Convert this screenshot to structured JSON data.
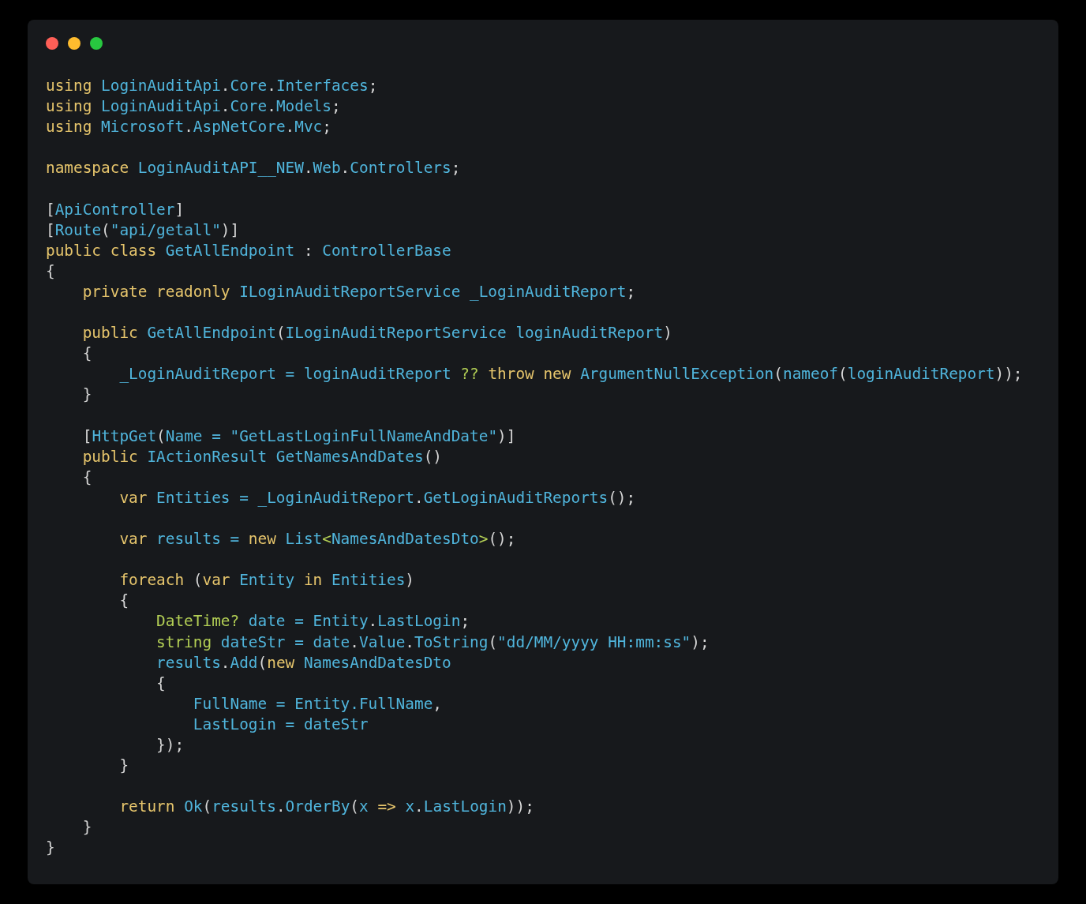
{
  "window": {
    "controls": [
      {
        "color": "#ff5f57"
      },
      {
        "color": "#febc2e"
      },
      {
        "color": "#28c840"
      }
    ]
  },
  "code": {
    "lines": [
      {
        "kind": "code",
        "tokens": [
          {
            "kind": "kw",
            "text": "using "
          },
          {
            "kind": "id",
            "text": "LoginAuditApi"
          },
          {
            "kind": "p",
            "text": "."
          },
          {
            "kind": "id",
            "text": "Core"
          },
          {
            "kind": "p",
            "text": "."
          },
          {
            "kind": "id",
            "text": "Interfaces"
          },
          {
            "kind": "p",
            "text": ";"
          }
        ]
      },
      {
        "kind": "code",
        "tokens": [
          {
            "kind": "kw",
            "text": "using "
          },
          {
            "kind": "id",
            "text": "LoginAuditApi"
          },
          {
            "kind": "p",
            "text": "."
          },
          {
            "kind": "id",
            "text": "Core"
          },
          {
            "kind": "p",
            "text": "."
          },
          {
            "kind": "id",
            "text": "Models"
          },
          {
            "kind": "p",
            "text": ";"
          }
        ]
      },
      {
        "kind": "code",
        "tokens": [
          {
            "kind": "kw",
            "text": "using "
          },
          {
            "kind": "id",
            "text": "Microsoft"
          },
          {
            "kind": "p",
            "text": "."
          },
          {
            "kind": "id",
            "text": "AspNetCore"
          },
          {
            "kind": "p",
            "text": "."
          },
          {
            "kind": "id",
            "text": "Mvc"
          },
          {
            "kind": "p",
            "text": ";"
          }
        ]
      },
      {
        "kind": "blank"
      },
      {
        "kind": "code",
        "tokens": [
          {
            "kind": "kw",
            "text": "namespace "
          },
          {
            "kind": "id",
            "text": "LoginAuditAPI__NEW"
          },
          {
            "kind": "p",
            "text": "."
          },
          {
            "kind": "id",
            "text": "Web"
          },
          {
            "kind": "p",
            "text": "."
          },
          {
            "kind": "id",
            "text": "Controllers"
          },
          {
            "kind": "p",
            "text": ";"
          }
        ]
      },
      {
        "kind": "blank"
      },
      {
        "kind": "code",
        "tokens": [
          {
            "kind": "p",
            "text": "["
          },
          {
            "kind": "id",
            "text": "ApiController"
          },
          {
            "kind": "p",
            "text": "]"
          }
        ]
      },
      {
        "kind": "code",
        "tokens": [
          {
            "kind": "p",
            "text": "["
          },
          {
            "kind": "id",
            "text": "Route"
          },
          {
            "kind": "p",
            "text": "("
          },
          {
            "kind": "id",
            "text": "\"api/getall\""
          },
          {
            "kind": "p",
            "text": ")]"
          }
        ]
      },
      {
        "kind": "code",
        "tokens": [
          {
            "kind": "kw",
            "text": "public class "
          },
          {
            "kind": "id",
            "text": "GetAllEndpoint "
          },
          {
            "kind": "p",
            "text": ": "
          },
          {
            "kind": "id",
            "text": "ControllerBase"
          }
        ]
      },
      {
        "kind": "code",
        "tokens": [
          {
            "kind": "p",
            "text": "{"
          }
        ]
      },
      {
        "kind": "code",
        "tokens": [
          {
            "kind": "kw",
            "text": "    private readonly "
          },
          {
            "kind": "id",
            "text": "ILoginAuditReportService _LoginAuditReport"
          },
          {
            "kind": "p",
            "text": ";"
          }
        ]
      },
      {
        "kind": "blank"
      },
      {
        "kind": "code",
        "tokens": [
          {
            "kind": "kw",
            "text": "    public "
          },
          {
            "kind": "id",
            "text": "GetAllEndpoint"
          },
          {
            "kind": "p",
            "text": "("
          },
          {
            "kind": "id",
            "text": "ILoginAuditReportService loginAuditReport"
          },
          {
            "kind": "p",
            "text": ")"
          }
        ]
      },
      {
        "kind": "code",
        "tokens": [
          {
            "kind": "p",
            "text": "    {"
          }
        ]
      },
      {
        "kind": "code",
        "tokens": [
          {
            "kind": "id",
            "text": "        _LoginAuditReport = loginAuditReport "
          },
          {
            "kind": "ty",
            "text": "?? "
          },
          {
            "kind": "kw",
            "text": "throw new "
          },
          {
            "kind": "id",
            "text": "ArgumentNullException"
          },
          {
            "kind": "p",
            "text": "("
          },
          {
            "kind": "id",
            "text": "nameof"
          },
          {
            "kind": "p",
            "text": "("
          },
          {
            "kind": "id",
            "text": "loginAuditReport"
          },
          {
            "kind": "p",
            "text": "));"
          }
        ]
      },
      {
        "kind": "code",
        "tokens": [
          {
            "kind": "p",
            "text": "    }"
          }
        ]
      },
      {
        "kind": "blank"
      },
      {
        "kind": "code",
        "tokens": [
          {
            "kind": "p",
            "text": "    ["
          },
          {
            "kind": "id",
            "text": "HttpGet"
          },
          {
            "kind": "p",
            "text": "("
          },
          {
            "kind": "id",
            "text": "Name = \"GetLastLoginFullNameAndDate\""
          },
          {
            "kind": "p",
            "text": ")]"
          }
        ]
      },
      {
        "kind": "code",
        "tokens": [
          {
            "kind": "kw",
            "text": "    public "
          },
          {
            "kind": "id",
            "text": "IActionResult GetNamesAndDates"
          },
          {
            "kind": "p",
            "text": "()"
          }
        ]
      },
      {
        "kind": "code",
        "tokens": [
          {
            "kind": "p",
            "text": "    {"
          }
        ]
      },
      {
        "kind": "code",
        "tokens": [
          {
            "kind": "kw",
            "text": "        var "
          },
          {
            "kind": "id",
            "text": "Entities = _LoginAuditReport"
          },
          {
            "kind": "p",
            "text": "."
          },
          {
            "kind": "id",
            "text": "GetLoginAuditReports"
          },
          {
            "kind": "p",
            "text": "();"
          }
        ]
      },
      {
        "kind": "blank"
      },
      {
        "kind": "code",
        "tokens": [
          {
            "kind": "kw",
            "text": "        var "
          },
          {
            "kind": "id",
            "text": "results = "
          },
          {
            "kind": "kw",
            "text": "new "
          },
          {
            "kind": "id",
            "text": "List"
          },
          {
            "kind": "ty",
            "text": "<"
          },
          {
            "kind": "id",
            "text": "NamesAndDatesDto"
          },
          {
            "kind": "ty",
            "text": ">"
          },
          {
            "kind": "p",
            "text": "();"
          }
        ]
      },
      {
        "kind": "blank"
      },
      {
        "kind": "code",
        "tokens": [
          {
            "kind": "kw",
            "text": "        foreach "
          },
          {
            "kind": "p",
            "text": "("
          },
          {
            "kind": "kw",
            "text": "var "
          },
          {
            "kind": "id",
            "text": "Entity "
          },
          {
            "kind": "kw",
            "text": "in "
          },
          {
            "kind": "id",
            "text": "Entities"
          },
          {
            "kind": "p",
            "text": ")"
          }
        ]
      },
      {
        "kind": "code",
        "tokens": [
          {
            "kind": "p",
            "text": "        {"
          }
        ]
      },
      {
        "kind": "code",
        "tokens": [
          {
            "kind": "ty",
            "text": "            DateTime? "
          },
          {
            "kind": "id",
            "text": "date = Entity"
          },
          {
            "kind": "p",
            "text": "."
          },
          {
            "kind": "id",
            "text": "LastLogin"
          },
          {
            "kind": "p",
            "text": ";"
          }
        ]
      },
      {
        "kind": "code",
        "tokens": [
          {
            "kind": "ty",
            "text": "            string "
          },
          {
            "kind": "id",
            "text": "dateStr = date"
          },
          {
            "kind": "p",
            "text": "."
          },
          {
            "kind": "id",
            "text": "Value"
          },
          {
            "kind": "p",
            "text": "."
          },
          {
            "kind": "id",
            "text": "ToString"
          },
          {
            "kind": "p",
            "text": "("
          },
          {
            "kind": "id",
            "text": "\"dd/MM/yyyy HH:mm:ss\""
          },
          {
            "kind": "p",
            "text": ");"
          }
        ]
      },
      {
        "kind": "code",
        "tokens": [
          {
            "kind": "id",
            "text": "            results"
          },
          {
            "kind": "p",
            "text": "."
          },
          {
            "kind": "id",
            "text": "Add"
          },
          {
            "kind": "p",
            "text": "("
          },
          {
            "kind": "kw",
            "text": "new "
          },
          {
            "kind": "id",
            "text": "NamesAndDatesDto"
          }
        ]
      },
      {
        "kind": "code",
        "tokens": [
          {
            "kind": "p",
            "text": "            {"
          }
        ]
      },
      {
        "kind": "code",
        "tokens": [
          {
            "kind": "id",
            "text": "                FullName = Entity.FullName"
          },
          {
            "kind": "p",
            "text": ","
          }
        ]
      },
      {
        "kind": "code",
        "tokens": [
          {
            "kind": "id",
            "text": "                LastLogin = dateStr"
          }
        ]
      },
      {
        "kind": "code",
        "tokens": [
          {
            "kind": "p",
            "text": "            });"
          }
        ]
      },
      {
        "kind": "code",
        "tokens": [
          {
            "kind": "p",
            "text": "        }"
          }
        ]
      },
      {
        "kind": "blank"
      },
      {
        "kind": "code",
        "tokens": [
          {
            "kind": "kw",
            "text": "        return "
          },
          {
            "kind": "id",
            "text": "Ok"
          },
          {
            "kind": "p",
            "text": "("
          },
          {
            "kind": "id",
            "text": "results"
          },
          {
            "kind": "p",
            "text": "."
          },
          {
            "kind": "id",
            "text": "OrderBy"
          },
          {
            "kind": "p",
            "text": "("
          },
          {
            "kind": "id",
            "text": "x "
          },
          {
            "kind": "kw",
            "text": "=> "
          },
          {
            "kind": "id",
            "text": "x"
          },
          {
            "kind": "p",
            "text": "."
          },
          {
            "kind": "id",
            "text": "LastLogin"
          },
          {
            "kind": "p",
            "text": "));"
          }
        ]
      },
      {
        "kind": "code",
        "tokens": [
          {
            "kind": "p",
            "text": "    }"
          }
        ]
      },
      {
        "kind": "code",
        "tokens": [
          {
            "kind": "p",
            "text": "}"
          }
        ]
      }
    ]
  }
}
